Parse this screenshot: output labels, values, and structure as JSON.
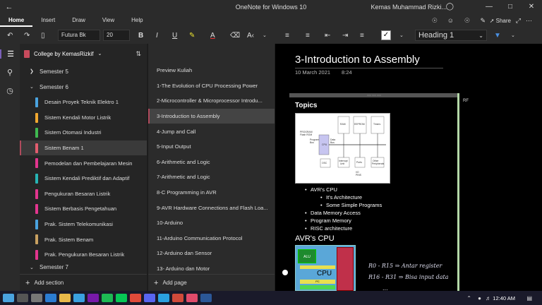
{
  "window": {
    "title": "OneNote for Windows 10",
    "user": "Kemas Muhammad Rizki..."
  },
  "menu": {
    "tabs": [
      "Home",
      "Insert",
      "Draw",
      "View",
      "Help"
    ],
    "share": "Share"
  },
  "ribbon": {
    "font": "Futura Bk",
    "size": "20",
    "style": "Heading 1"
  },
  "notebook": {
    "name": "College by KemasRizkif",
    "groups": [
      {
        "label": "Semester 5",
        "expanded": false
      },
      {
        "label": "Semester 6",
        "expanded": true
      }
    ],
    "sections": [
      {
        "label": "Desain Proyek Teknik Elektro 1",
        "color": "#4aa3df"
      },
      {
        "label": "Sistem Kendali Motor Listrik",
        "color": "#f0a830"
      },
      {
        "label": "Sistem Otomasi Industri",
        "color": "#3fb950"
      },
      {
        "label": "Sistem Benam 1",
        "color": "#e25d6e",
        "active": true
      },
      {
        "label": "Pemodelan dan Pembelajaran Mesin",
        "color": "#e2358e"
      },
      {
        "label": "Sistem Kendali Prediktif dan Adaptif",
        "color": "#27b4b4"
      },
      {
        "label": "Pengukuran Besaran Listrik",
        "color": "#e2358e"
      },
      {
        "label": "Sistem Berbasis Pengetahuan",
        "color": "#e2358e"
      },
      {
        "label": "Prak. Sistem Telekomunikasi",
        "color": "#4aa3df"
      },
      {
        "label": "Prak. Sistem Benam",
        "color": "#c8a060"
      },
      {
        "label": "Prak. Pengukuran Besaran Listrik",
        "color": "#e2358e"
      }
    ],
    "next_group": "Semester 7",
    "add_section": "Add section"
  },
  "pages": {
    "items": [
      "Preview Kuliah",
      "1-The Evolution of CPU Processing Power",
      "2-Microcontroller & Microprocessor Introdu...",
      "3-Introduction to Assembly",
      "4-Jump and Call",
      "5-Input Output",
      "6-Arithmetic and Logic",
      "7-Arithmetic and Logic",
      "8-C Programming in AVR",
      "9-AVR Hardware Connections and Flash Loa...",
      "10-Arduino",
      "11-Arduino Communication Protocol",
      "12-Arduino dan Sensor",
      "13- Arduino dan Motor"
    ],
    "active_index": 3,
    "add_page": "Add page"
  },
  "page": {
    "title": "3-Introduction to Assembly",
    "date": "10 March 2021",
    "time": "8:24",
    "topics_heading": "Topics",
    "bullets": [
      {
        "text": "AVR's CPU",
        "level": 1
      },
      {
        "text": "It's Architecture",
        "level": 2
      },
      {
        "text": "Some Simple Programs",
        "level": 2
      },
      {
        "text": "Data Memory Access",
        "level": 1
      },
      {
        "text": "Program Memory",
        "level": 1
      },
      {
        "text": "RISC architecture",
        "level": 1
      }
    ],
    "avr_heading": "AVR's CPU",
    "chip_labels": {
      "alu": "ALU",
      "cpu": "CPU",
      "pc": "PC"
    },
    "handwriting": [
      "R0 - R15 ⇒ Antar register",
      "R16 - R31 ⇒ Bisa input data",
      "..."
    ],
    "diagram_labels": {
      "program_flash": "PROGRAM\nFlash ROM",
      "program_bus": "Program\nBus",
      "cpu": "CPU",
      "data_bus": "Data\nBus",
      "ram": "RAM",
      "eeprom": "EEPROM",
      "timers": "Timers",
      "osc": "OSC",
      "interrupt_unit": "Interrupt\nUnit",
      "ports": "Ports",
      "other_peripherals": "Other\nPeripherals",
      "io_pins": "I/O\nPINS"
    },
    "rf": "RF"
  },
  "taskbar": {
    "time": "12:40 AM"
  }
}
